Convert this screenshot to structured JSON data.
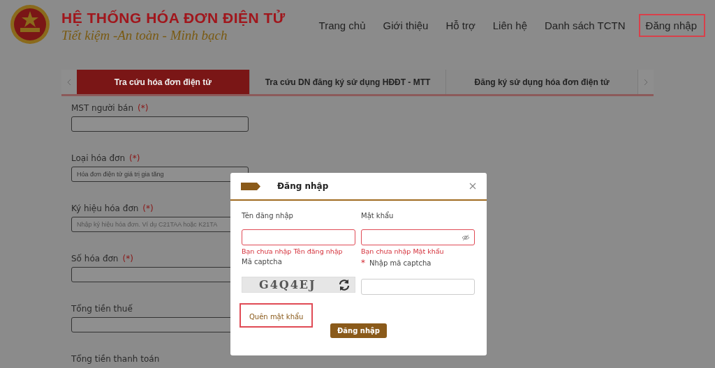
{
  "header": {
    "title": "HỆ THỐNG HÓA ĐƠN ĐIỆN TỬ",
    "slogan": "Tiết kiệm -An toàn - Minh bạch"
  },
  "nav": [
    {
      "label": "Trang chủ",
      "highlighted": false
    },
    {
      "label": "Giới thiệu",
      "highlighted": false
    },
    {
      "label": "Hỗ trợ",
      "highlighted": false
    },
    {
      "label": "Liên hệ",
      "highlighted": false
    },
    {
      "label": "Danh sách TCTN",
      "highlighted": false
    },
    {
      "label": "Đăng nhập",
      "highlighted": true
    }
  ],
  "tabs": [
    {
      "label": "Tra cứu hóa đơn điện tử",
      "selected": true
    },
    {
      "label": "Tra cứu DN đăng ký sử dụng HĐĐT - MTT",
      "selected": false
    },
    {
      "label": "Đăng ký sử dụng hóa đơn điện tử",
      "selected": false
    }
  ],
  "form_fields": [
    {
      "label": "MST người bán",
      "required_mark": "(*)"
    },
    {
      "label": "Loại hóa đơn",
      "required_mark": "(*)",
      "value": "Hóa đơn điện tử giá trị gia tăng"
    },
    {
      "label": "Ký hiệu hóa đơn",
      "required_mark": "(*)",
      "placeholder": "Nhập ký hiệu hóa đơn. Ví dụ C21TAA hoặc K21TA"
    },
    {
      "label": "Số hóa đơn",
      "required_mark": "(*)"
    },
    {
      "label": "Tổng tiền thuế"
    },
    {
      "label": "Tổng tiền thanh toán"
    }
  ],
  "dialog": {
    "title": "Đăng nhập",
    "fields": [
      {
        "label": "Tên đăng nhập",
        "kind": "text",
        "error": "Bạn chưa nhập Tên đăng nhập"
      },
      {
        "label": "Mật khẩu",
        "kind": "password",
        "error": "Bạn chưa nhập Mật khẩu"
      }
    ],
    "captcha_label": "Mã captcha",
    "captcha_text": "G4Q4EJ",
    "captcha_input_label": "Nhập mã captcha",
    "captcha_required_mark": "*",
    "forgot_link": {
      "label": "Quên mật khẩu",
      "highlighted": true
    },
    "submit": "Đăng nhập"
  }
}
